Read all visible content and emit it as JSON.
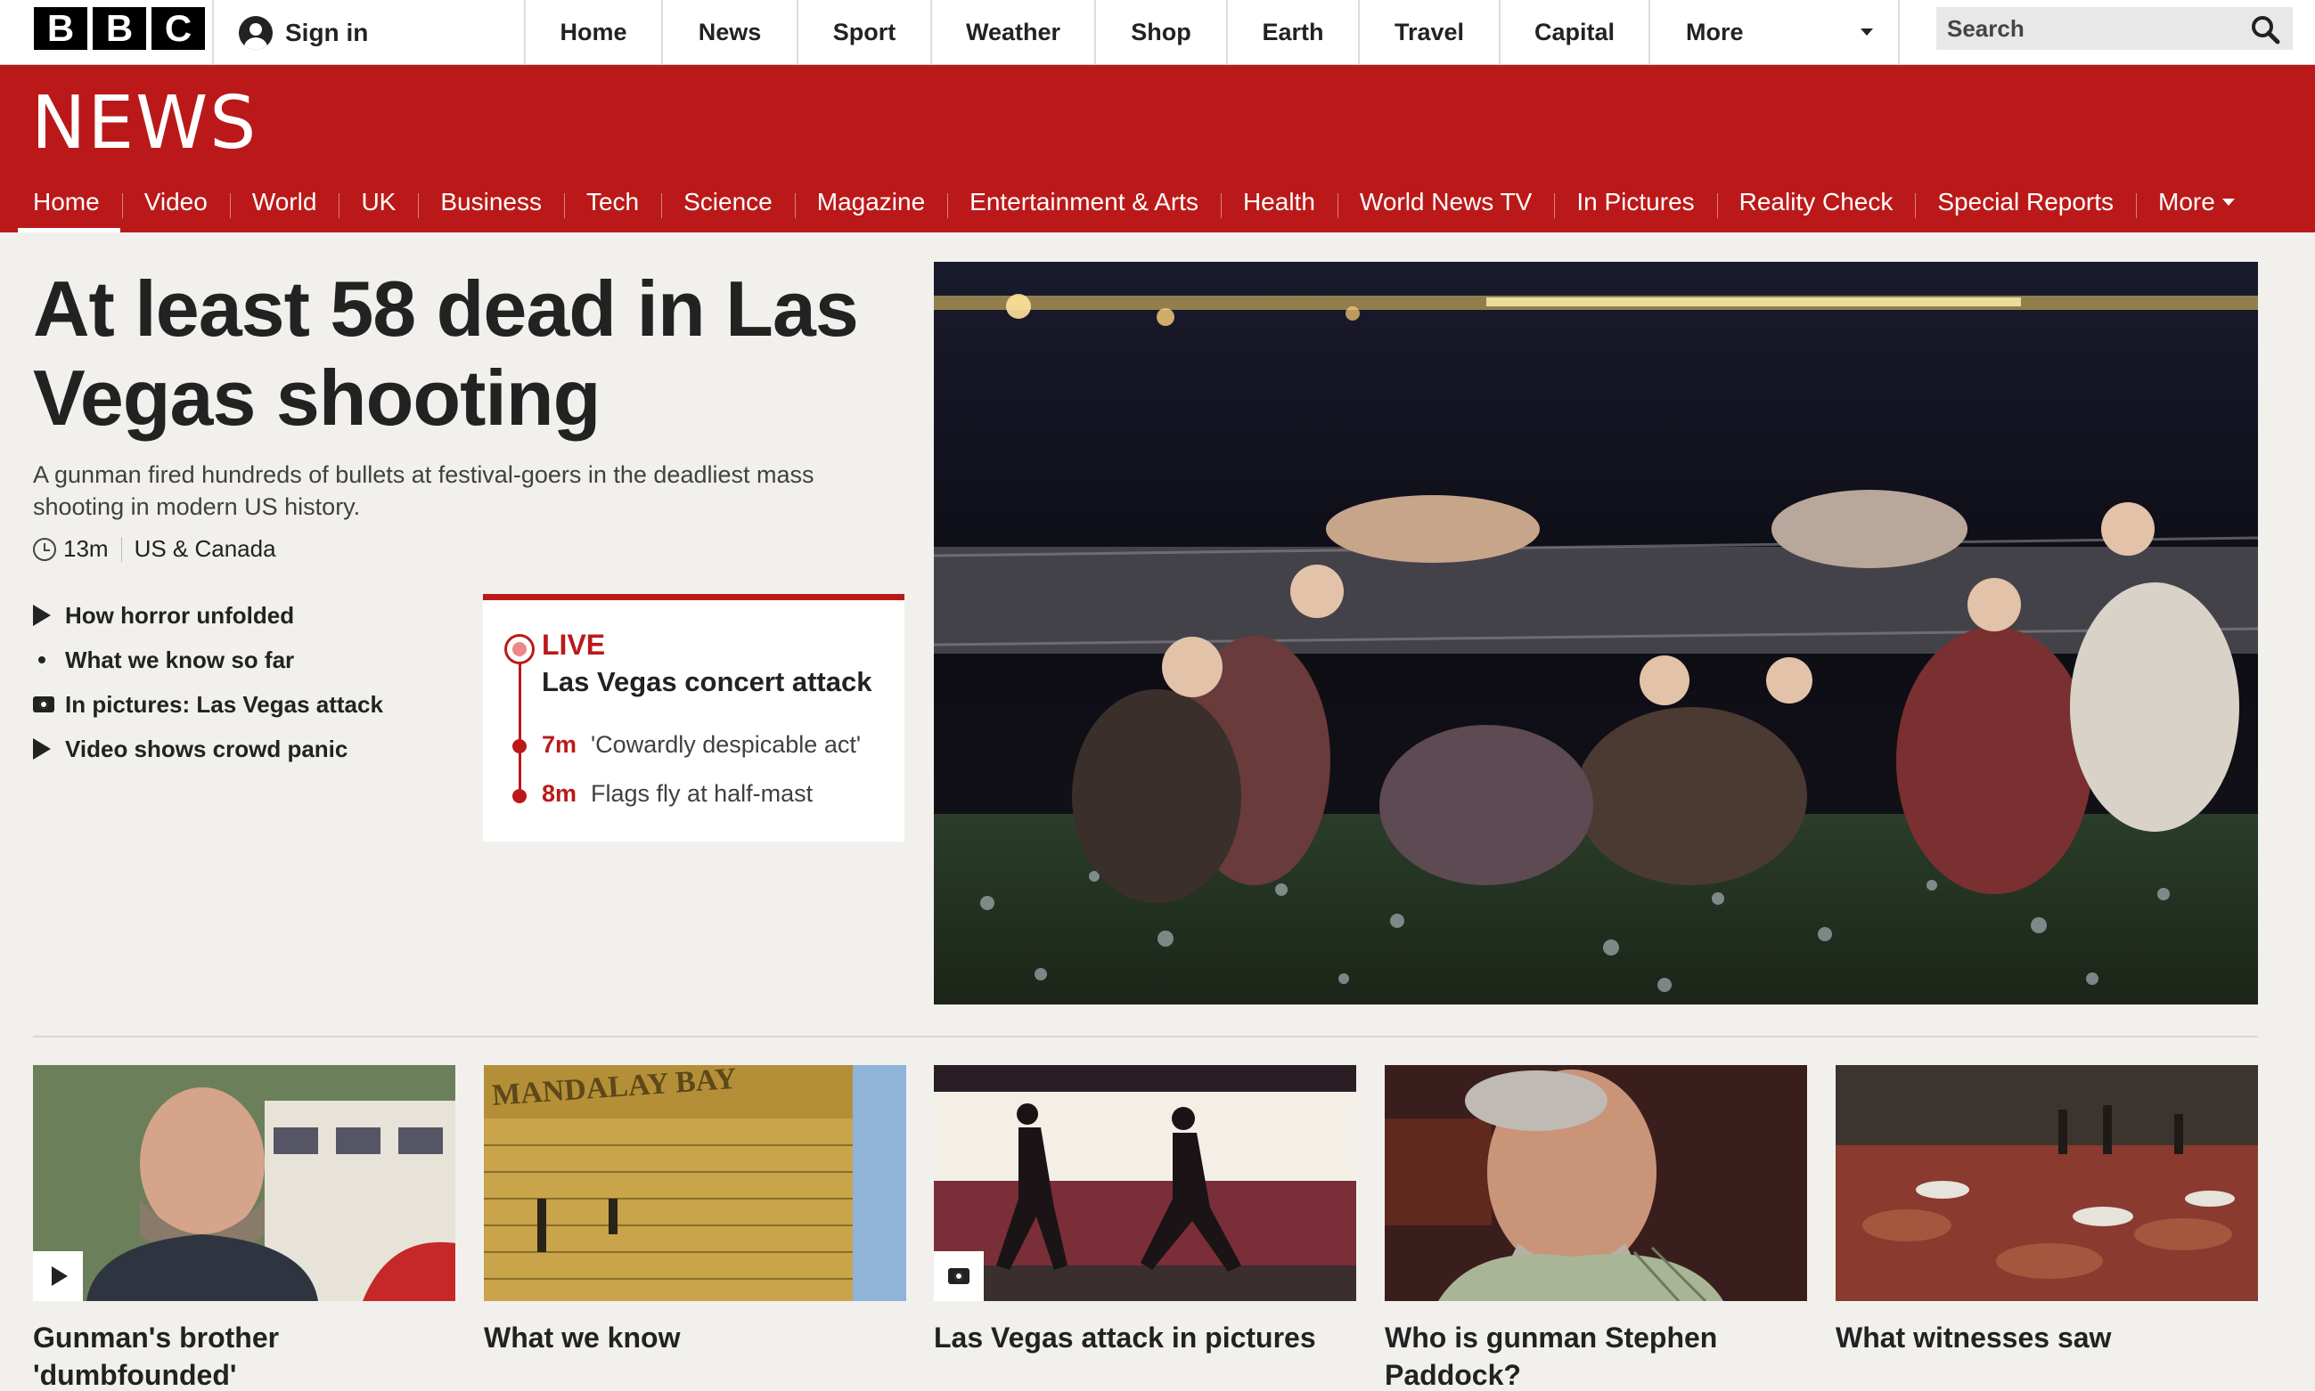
{
  "brand": {
    "letters": [
      "B",
      "B",
      "C"
    ],
    "section_logo": "NEWS"
  },
  "topbar": {
    "sign_in": "Sign in",
    "nav": [
      "Home",
      "News",
      "Sport",
      "Weather",
      "Shop",
      "Earth",
      "Travel",
      "Capital"
    ],
    "more": "More",
    "search_placeholder": "Search"
  },
  "subnav": {
    "items": [
      "Home",
      "Video",
      "World",
      "UK",
      "Business",
      "Tech",
      "Science",
      "Magazine",
      "Entertainment & Arts",
      "Health",
      "World News TV",
      "In Pictures",
      "Reality Check",
      "Special Reports"
    ],
    "more": "More",
    "active": "Home"
  },
  "lead": {
    "headline": "At least 58 dead in Las Vegas shooting",
    "summary": "A gunman fired hundreds of bullets at festival-goers in the deadliest mass shooting in modern US history.",
    "time": "13m",
    "section": "US & Canada",
    "related": [
      {
        "icon": "play-icon",
        "label": "How horror unfolded"
      },
      {
        "icon": "dot-icon",
        "label": "What we know so far"
      },
      {
        "icon": "camera-icon",
        "label": "In pictures: Las Vegas attack"
      },
      {
        "icon": "play-icon",
        "label": "Video shows crowd panic"
      }
    ]
  },
  "live": {
    "label": "LIVE",
    "title": "Las Vegas concert attack",
    "entries": [
      {
        "time": "7m",
        "text": "'Cowardly despicable act'"
      },
      {
        "time": "8m",
        "text": "Flags fly at half-mast"
      }
    ]
  },
  "cards": [
    {
      "caption": "Gunman's brother 'dumbfounded'",
      "badge": "play-icon"
    },
    {
      "caption": "What we know",
      "sign_text": "MANDALAY BAY"
    },
    {
      "caption": "Las Vegas attack in pictures",
      "badge": "camera-icon"
    },
    {
      "caption": "Who is gunman Stephen Paddock?"
    },
    {
      "caption": "What witnesses saw"
    }
  ],
  "colors": {
    "bbc_red": "#bb1919",
    "background": "#f2f0ed",
    "text": "#222222"
  }
}
